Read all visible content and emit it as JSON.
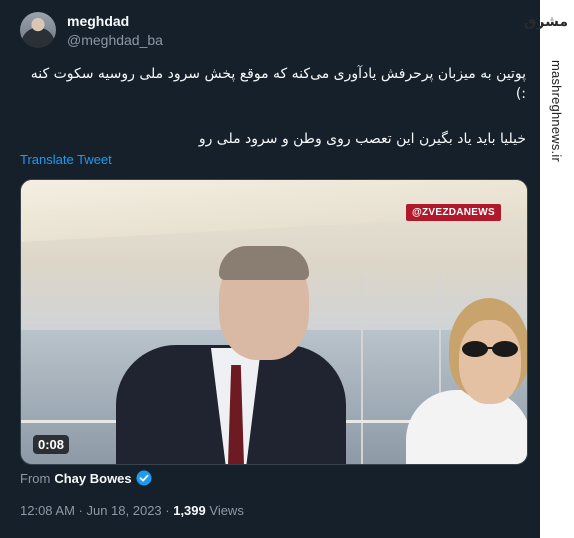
{
  "tweet": {
    "name": "meghdad",
    "handle": "@meghdad_ba",
    "text_line1": "پوتین به میزبان پرحرفش یادآوری می‌کنه که موقع پخش سرود ملی روسیه سکوت کنه :)",
    "text_line2": "خیلیا باید یاد بگیرن این تعصب روی وطن و سرود ملی رو",
    "translate_label": "Translate Tweet",
    "media": {
      "watermark": "@ZVEZDANEWS",
      "duration": "0:08"
    },
    "from_prefix": "From",
    "from_source": "Chay Bowes",
    "time": "12:08 AM · Jun 18, 2023 · ",
    "views_count": "1,399",
    "views_label": " Views"
  },
  "sidebar": {
    "logo": "مشرق",
    "url": "mashreghnews.ir"
  },
  "colors": {
    "background": "#15202b",
    "link": "#1d9bf0",
    "secondary_text": "#8b98a5",
    "verified": "#1d9bf0"
  }
}
